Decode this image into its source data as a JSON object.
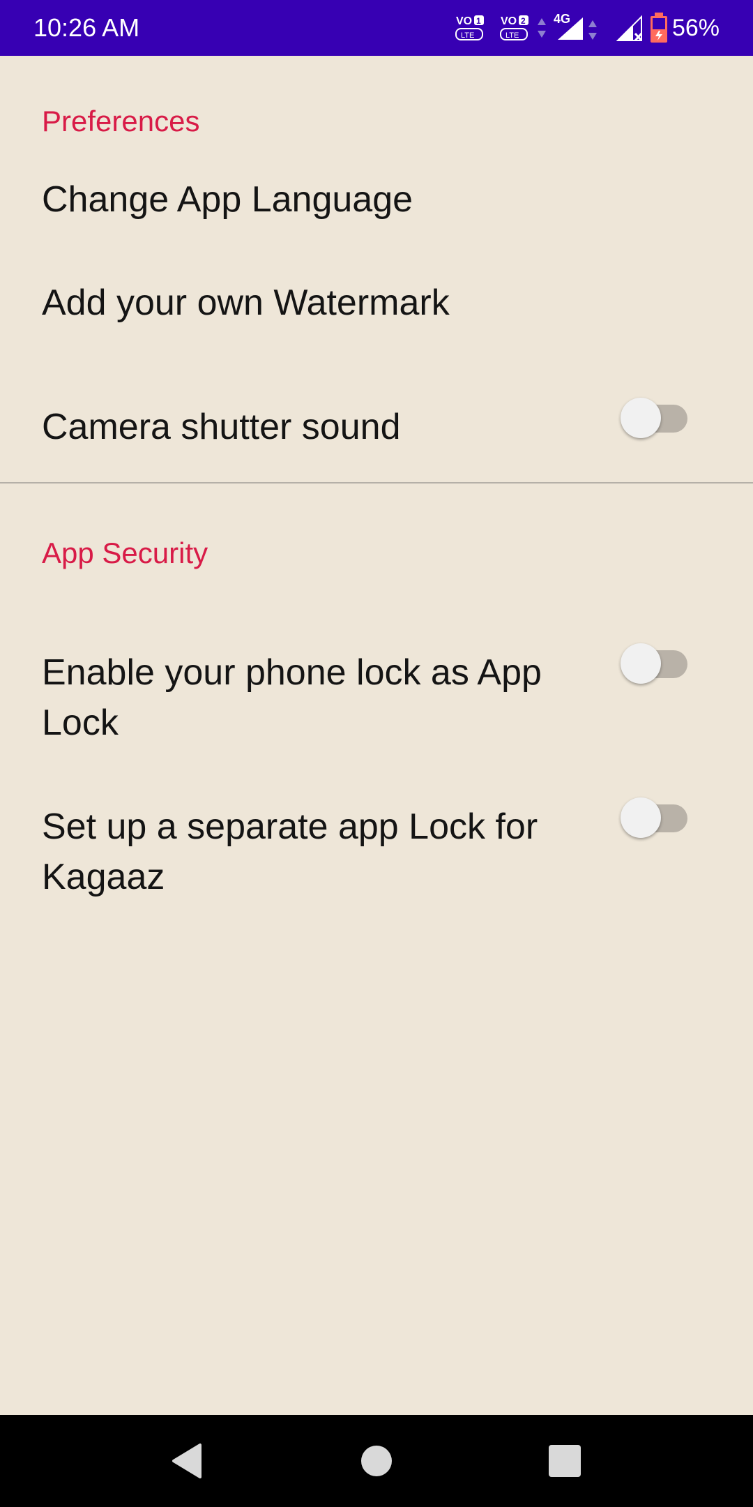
{
  "status_bar": {
    "time": "10:26 AM",
    "sim1_label": "VO 1 LTE",
    "sim2_label": "VO 2 LTE",
    "network_type": "4G",
    "battery_percent": "56%",
    "background_color": "#3700B3"
  },
  "preferences": {
    "header": "Preferences",
    "items": [
      {
        "title": "Change App Language"
      },
      {
        "title": "Add your own Watermark"
      },
      {
        "title": "Camera shutter sound",
        "switch_on": false
      }
    ]
  },
  "app_security": {
    "header": "App Security",
    "items": [
      {
        "title": "Enable your phone lock as App Lock",
        "switch_on": false
      },
      {
        "title": "Set up a separate app Lock for Kagaaz",
        "switch_on": false
      }
    ]
  },
  "colors": {
    "accent": "#D81B47",
    "background": "#EEE6D8",
    "text": "#141414"
  },
  "nav_bar": {
    "icons": [
      "back-icon",
      "home-icon",
      "recents-icon"
    ]
  }
}
